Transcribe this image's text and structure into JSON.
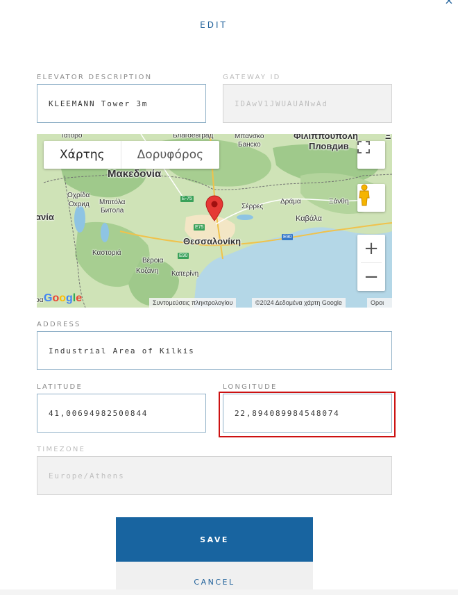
{
  "dialog": {
    "title": "EDIT",
    "close_label": "×"
  },
  "fields": {
    "elevator_description": {
      "label": "ELEVATOR DESCRIPTION",
      "value": "KLEEMANN Tower 3m"
    },
    "gateway_id": {
      "label": "GATEWAY ID",
      "value": "IDAwV1JWUAUANwAd"
    },
    "address": {
      "label": "ADDRESS",
      "value": "Industrial Area of Kilkis"
    },
    "latitude": {
      "label": "LATITUDE",
      "value": "41,00694982500844"
    },
    "longitude": {
      "label": "LONGITUDE",
      "value": "22,894089984548074"
    },
    "timezone": {
      "label": "TIMEZONE",
      "value": "Europe/Athens"
    }
  },
  "map": {
    "map_type_map": "Χάρτης",
    "map_type_satellite": "Δορυφόρος",
    "zoom_in": "+",
    "zoom_out": "−",
    "attribution_shortcuts": "Συντομεύσεις πληκτρολογίου",
    "attribution_data": "©2024 Δεδομένα χάρτη Google",
    "attribution_terms": "Οροι",
    "labels": {
      "tatovo": "Τατοβο",
      "blagoevgrad": "Благоевград",
      "mpansko": "Μπανσκο",
      "bansko": "Банско",
      "filippoupoli": "Φιλιππούπολη",
      "plovdiv": "Пловдив",
      "makedonia": "Μακεδονία",
      "ochrida": "Οχρίδα",
      "ohrid": "Охрид",
      "bitola_el": "Μπιτόλα",
      "bitola": "Битола",
      "albania": "ανία",
      "serres": "Σέρρες",
      "drama": "Δράμα",
      "xanthi": "Ξάνθη",
      "kavala": "Καβάλα",
      "thessaloniki": "Θεσσαλονίκη",
      "kastoria": "Καστοριά",
      "veroia": "Βέροια",
      "kozani": "Κοζάνη",
      "katerini": "Κατερίνη",
      "edge_letter": "Ξ",
      "albania_edge": "ρα"
    },
    "roads": {
      "e75_top": "E-75",
      "e75": "E75",
      "e90": "E90",
      "e90_east": "E90"
    },
    "google_letters": [
      "G",
      "o",
      "o",
      "g",
      "l",
      "e"
    ]
  },
  "actions": {
    "save": "SAVE",
    "cancel": "CANCEL"
  },
  "colors": {
    "accent": "#1864a0",
    "highlight": "#cc1111",
    "marker": "#e53935"
  }
}
